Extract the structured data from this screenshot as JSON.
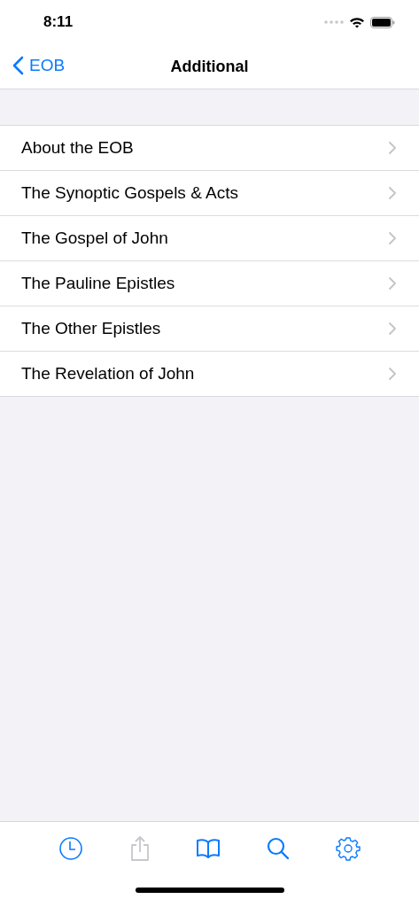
{
  "status_bar": {
    "time": "8:11"
  },
  "nav": {
    "back": "EOB",
    "title": "Additional"
  },
  "items": [
    {
      "label": "About the EOB"
    },
    {
      "label": "The Synoptic Gospels & Acts"
    },
    {
      "label": "The Gospel of John"
    },
    {
      "label": "The Pauline Epistles"
    },
    {
      "label": "The Other Epistles"
    },
    {
      "label": "The Revelation of John"
    }
  ],
  "toolbar": [
    {
      "kind": "history",
      "disabled": false
    },
    {
      "kind": "share",
      "disabled": true
    },
    {
      "kind": "book",
      "disabled": false
    },
    {
      "kind": "search",
      "disabled": false
    },
    {
      "kind": "settings",
      "disabled": false
    }
  ]
}
